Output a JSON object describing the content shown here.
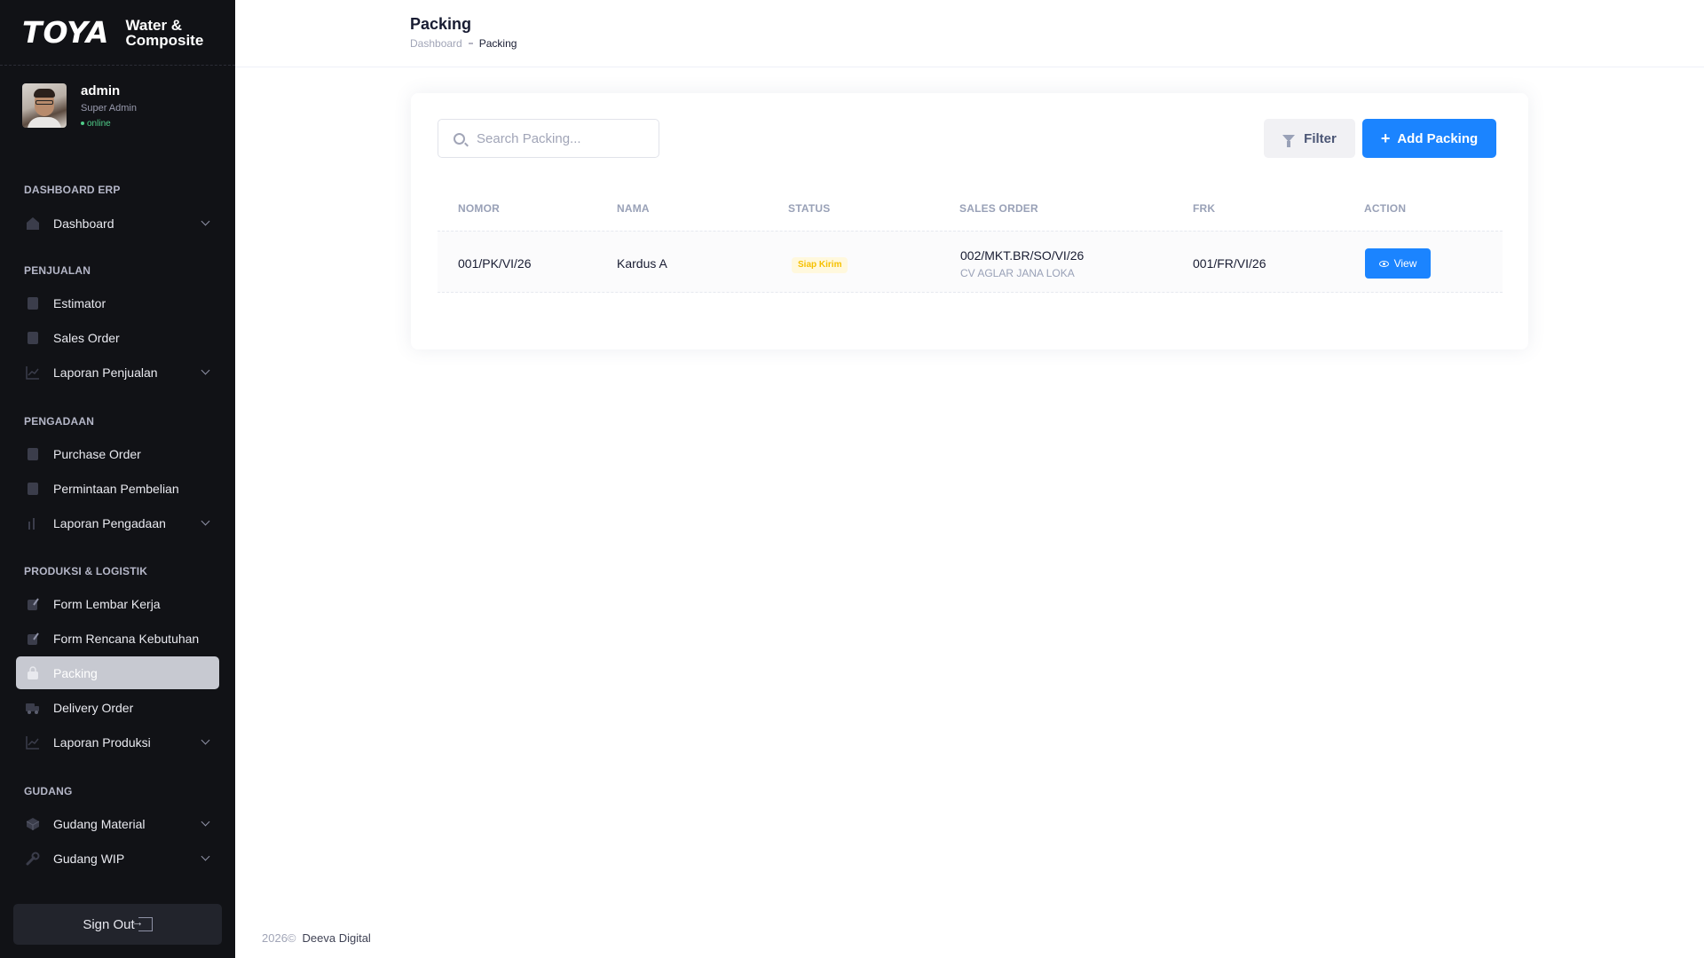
{
  "brand": {
    "logo": "TOYA",
    "subtitle_line1": "Water &",
    "subtitle_line2": "Composite"
  },
  "user": {
    "name": "admin",
    "role": "Super Admin",
    "status": "online"
  },
  "sidebar": {
    "sections": [
      {
        "title": "DASHBOARD ERP",
        "items": [
          {
            "label": "Dashboard",
            "icon": "home-icon",
            "has_submenu": true
          }
        ]
      },
      {
        "title": "PENJUALAN",
        "items": [
          {
            "label": "Estimator",
            "icon": "document-icon",
            "has_submenu": false
          },
          {
            "label": "Sales Order",
            "icon": "document-icon",
            "has_submenu": false
          },
          {
            "label": "Laporan Penjualan",
            "icon": "line-chart-icon",
            "has_submenu": true
          }
        ]
      },
      {
        "title": "PENGADAAN",
        "items": [
          {
            "label": "Purchase Order",
            "icon": "document-icon",
            "has_submenu": false
          },
          {
            "label": "Permintaan Pembelian",
            "icon": "document-icon",
            "has_submenu": false
          },
          {
            "label": "Laporan Pengadaan",
            "icon": "bar-chart-icon",
            "has_submenu": true
          }
        ]
      },
      {
        "title": "PRODUKSI & LOGISTIK",
        "items": [
          {
            "label": "Form Lembar Kerja",
            "icon": "pencil-doc-icon",
            "has_submenu": false
          },
          {
            "label": "Form Rencana Kebutuhan",
            "icon": "pencil-doc-icon",
            "has_submenu": false
          },
          {
            "label": "Packing",
            "icon": "bag-icon",
            "has_submenu": false,
            "active": true
          },
          {
            "label": "Delivery Order",
            "icon": "truck-icon",
            "has_submenu": false
          },
          {
            "label": "Laporan Produksi",
            "icon": "line-chart-icon",
            "has_submenu": true
          }
        ]
      },
      {
        "title": "GUDANG",
        "items": [
          {
            "label": "Gudang Material",
            "icon": "cube-icon",
            "has_submenu": true
          },
          {
            "label": "Gudang WIP",
            "icon": "wrench-icon",
            "has_submenu": true
          }
        ]
      }
    ],
    "signout_label": "Sign Out"
  },
  "header": {
    "title": "Packing",
    "breadcrumb": [
      "Dashboard",
      "Packing"
    ]
  },
  "toolbar": {
    "search_placeholder": "Search Packing...",
    "filter_label": "Filter",
    "add_label": "Add Packing"
  },
  "table": {
    "columns": [
      "NOMOR",
      "NAMA",
      "STATUS",
      "SALES ORDER",
      "FRK",
      "ACTION"
    ],
    "rows": [
      {
        "nomor": "001/PK/VI/26",
        "nama": "Kardus A",
        "status": "Siap Kirim",
        "sales_order": "002/MKT.BR/SO/VI/26",
        "customer": "CV AGLAR JANA LOKA",
        "frk": "001/FR/VI/26",
        "action": "View"
      }
    ]
  },
  "footer": {
    "year": "2026©",
    "company": "Deeva Digital"
  },
  "colors": {
    "sidebar_bg": "#111216",
    "primary": "#1b84ff",
    "active_item": "#c7c9d1",
    "badge_text": "#f6c000",
    "status_online": "#50cd89"
  }
}
